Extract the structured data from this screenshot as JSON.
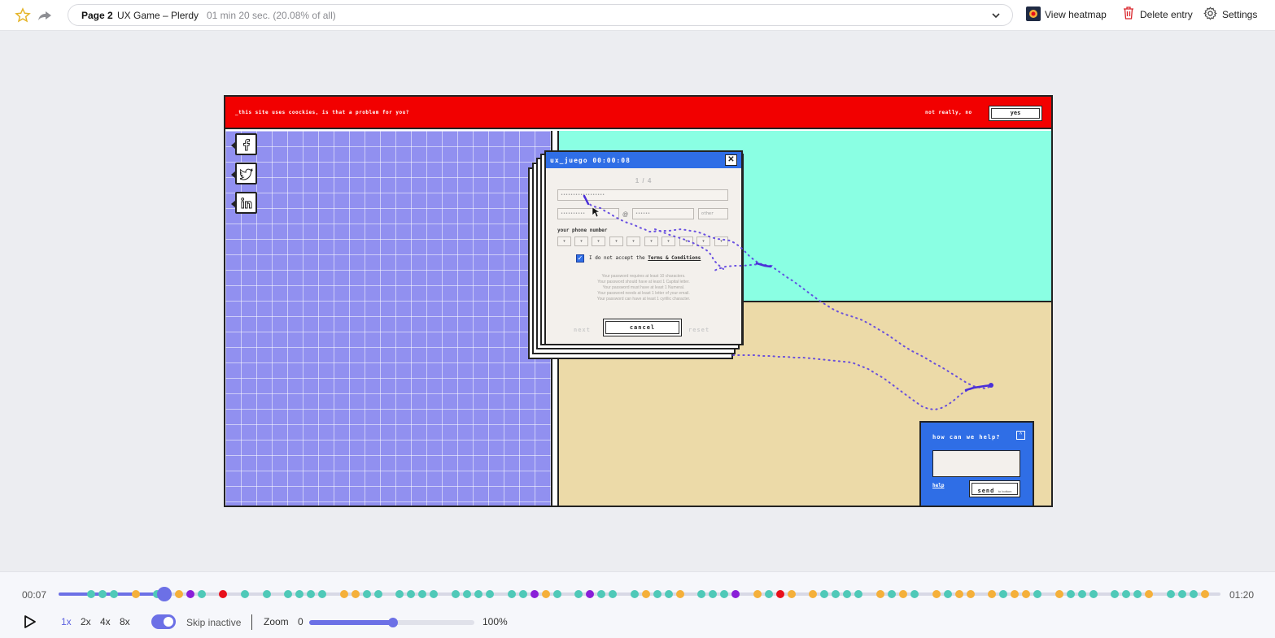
{
  "header": {
    "page_label": "Page 2",
    "page_name": "UX Game – Plerdy",
    "duration": "01 min 20 sec. (20.08% of all)",
    "actions": {
      "view_heatmap": "View heatmap",
      "delete_entry": "Delete entry",
      "settings": "Settings"
    }
  },
  "recording": {
    "cookie_bar": {
      "message": "_this site uses coockies, is that a problem for you?",
      "decline": "not really, no",
      "accept": "yes"
    },
    "dialog": {
      "title": "ux_juego 00:00:08",
      "close": "✕",
      "step": "1 / 4",
      "password_value": "••••••••••••••••••",
      "email_user_value": "••••••••••",
      "at_sign": "@",
      "email_domain_value": "••••••",
      "domain_select": "other",
      "phone_label": "your phone number",
      "phone_boxes": [
        "▾",
        "▾",
        "▾",
        "▾",
        "▾",
        "▾",
        "▾",
        "▾",
        "▾",
        "▾"
      ],
      "terms_prefix": "I do not accept the",
      "terms_link": "Terms & Conditions",
      "rules": [
        "Your password requires at least 10 characters.",
        "Your password should have at least 1 Capital letter.",
        "Your password must have at least 1 Numeral.",
        "Your password needs at least 1 letter of your email.",
        "Your password can have at least 1 cyrillic character."
      ],
      "next": "next",
      "cancel": "cancel",
      "reset": "reset"
    },
    "help_widget": {
      "title": "how can we help?",
      "toggle": "^",
      "link": "help",
      "send": "send",
      "send_small": "to bottom"
    },
    "colors": {
      "cookie_bar": "#f20000",
      "grid_panel": "#9190f0",
      "cyan_panel": "#8affe3",
      "sand_panel": "#ecdaa8",
      "dialog_title": "#2f6ee6",
      "mouse_trail": "#5b3fe0"
    }
  },
  "player": {
    "time_start": "00:07",
    "time_end": "01:20",
    "progress": 0.09,
    "events": [
      "teal",
      "teal",
      "teal",
      "orange",
      "teal",
      "orange",
      "purple",
      "teal",
      "red",
      "teal",
      "teal",
      "teal",
      "teal",
      "teal",
      "teal",
      "orange",
      "orange",
      "teal",
      "teal",
      "teal",
      "teal",
      "teal",
      "teal",
      "teal",
      "teal",
      "teal",
      "teal",
      "teal",
      "teal",
      "purple",
      "orange",
      "teal",
      "teal",
      "purple",
      "teal",
      "teal",
      "teal",
      "orange",
      "teal",
      "teal",
      "orange",
      "teal",
      "teal",
      "teal",
      "purple",
      "orange",
      "teal",
      "red",
      "orange",
      "orange",
      "teal",
      "teal",
      "teal",
      "teal",
      "orange",
      "teal",
      "orange",
      "teal",
      "orange",
      "teal",
      "orange",
      "orange",
      "orange",
      "teal",
      "orange",
      "orange",
      "teal",
      "orange",
      "teal",
      "teal",
      "teal",
      "teal",
      "teal",
      "teal",
      "orange",
      "teal",
      "teal",
      "teal",
      "orange"
    ],
    "event_colors": {
      "teal": "#4fc9b8",
      "orange": "#f5b03a",
      "purple": "#8a1fd8",
      "red": "#e8101b"
    },
    "speeds": [
      "1x",
      "2x",
      "4x",
      "8x"
    ],
    "active_speed": "1x",
    "skip_inactive": "Skip inactive",
    "skip_inactive_on": true,
    "zoom_label": "Zoom",
    "zoom_min": "0",
    "zoom_max": "100%",
    "zoom_level": 0.5
  }
}
